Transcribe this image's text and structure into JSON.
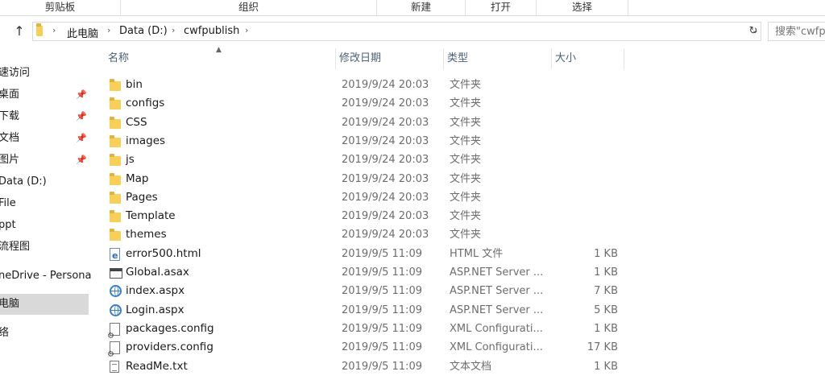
{
  "ribbon": {
    "groups": [
      "剪贴板",
      "组织",
      "新建",
      "打开",
      "选择"
    ]
  },
  "address": {
    "crumbs": [
      "此电脑",
      "Data (D:)",
      "cwfpublish"
    ],
    "search_placeholder": "搜索\"cwfpublish\""
  },
  "nav": {
    "items": [
      {
        "label": "速访问",
        "pinned": false
      },
      {
        "label": "桌面",
        "pinned": true
      },
      {
        "label": "下载",
        "pinned": true
      },
      {
        "label": "文档",
        "pinned": true
      },
      {
        "label": "图片",
        "pinned": true
      },
      {
        "label": "Data (D:)",
        "pinned": false
      },
      {
        "label": "File",
        "pinned": false
      },
      {
        "label": "ppt",
        "pinned": false
      },
      {
        "label": "流程图",
        "pinned": false
      },
      {
        "label": "neDrive - Persona",
        "pinned": false
      },
      {
        "label": "电脑",
        "pinned": false,
        "selected": true
      },
      {
        "label": "络",
        "pinned": false
      }
    ]
  },
  "columns": {
    "name": "名称",
    "date": "修改日期",
    "type": "类型",
    "size": "大小"
  },
  "files": [
    {
      "name": "bin",
      "date": "2019/9/24 20:03",
      "type": "文件夹",
      "size": "",
      "icon": "folder-icon"
    },
    {
      "name": "configs",
      "date": "2019/9/24 20:03",
      "type": "文件夹",
      "size": "",
      "icon": "folder-icon"
    },
    {
      "name": "CSS",
      "date": "2019/9/24 20:03",
      "type": "文件夹",
      "size": "",
      "icon": "folder-icon"
    },
    {
      "name": "images",
      "date": "2019/9/24 20:03",
      "type": "文件夹",
      "size": "",
      "icon": "folder-icon"
    },
    {
      "name": "js",
      "date": "2019/9/24 20:03",
      "type": "文件夹",
      "size": "",
      "icon": "folder-icon"
    },
    {
      "name": "Map",
      "date": "2019/9/24 20:03",
      "type": "文件夹",
      "size": "",
      "icon": "folder-icon"
    },
    {
      "name": "Pages",
      "date": "2019/9/24 20:03",
      "type": "文件夹",
      "size": "",
      "icon": "folder-icon"
    },
    {
      "name": "Template",
      "date": "2019/9/24 20:03",
      "type": "文件夹",
      "size": "",
      "icon": "folder-icon"
    },
    {
      "name": "themes",
      "date": "2019/9/24 20:03",
      "type": "文件夹",
      "size": "",
      "icon": "folder-icon"
    },
    {
      "name": "error500.html",
      "date": "2019/9/5 11:09",
      "type": "HTML 文件",
      "size": "1 KB",
      "icon": "html-file-icon"
    },
    {
      "name": "Global.asax",
      "date": "2019/9/5 11:09",
      "type": "ASP.NET Server ...",
      "size": "1 KB",
      "icon": "asax-file-icon"
    },
    {
      "name": "index.aspx",
      "date": "2019/9/5 11:09",
      "type": "ASP.NET Server ...",
      "size": "7 KB",
      "icon": "globe-icon"
    },
    {
      "name": "Login.aspx",
      "date": "2019/9/5 11:09",
      "type": "ASP.NET Server ...",
      "size": "5 KB",
      "icon": "globe-icon"
    },
    {
      "name": "packages.config",
      "date": "2019/9/5 11:09",
      "type": "XML Configurati...",
      "size": "1 KB",
      "icon": "config-file-icon"
    },
    {
      "name": "providers.config",
      "date": "2019/9/5 11:09",
      "type": "XML Configurati...",
      "size": "17 KB",
      "icon": "config-file-icon"
    },
    {
      "name": "ReadMe.txt",
      "date": "2019/9/5 11:09",
      "type": "文本文档",
      "size": "1 KB",
      "icon": "text-file-icon"
    }
  ]
}
